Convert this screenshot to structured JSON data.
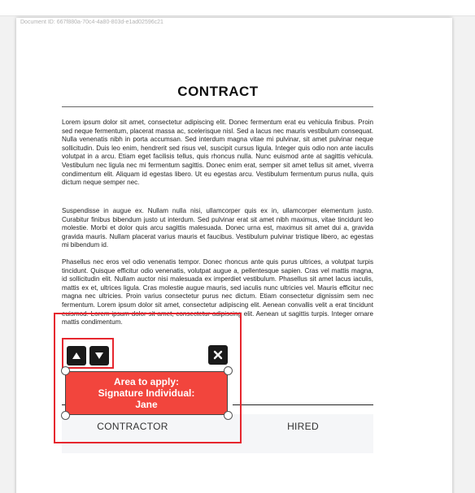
{
  "document": {
    "id_text": "Document ID: 667f880a-70c4-4a80-803d-e1ad02596c21",
    "title": "CONTRACT",
    "paragraphs": [
      "Lorem ipsum dolor sit amet, consectetur adipiscing elit. Donec fermentum erat eu vehicula finibus. Proin sed neque fermentum, placerat massa ac, scelerisque nisl. Sed a lacus nec mauris vestibulum consequat. Nulla venenatis nibh in porta accumsan. Sed interdum magna vitae mi pulvinar, sit amet pulvinar neque sollicitudin. Duis leo enim, hendrerit sed risus vel, suscipit cursus ligula. Integer quis odio non ante iaculis volutpat in a arcu. Etiam eget facilisis tellus, quis rhoncus nulla. Nunc euismod ante at sagittis vehicula. Vestibulum nec ligula nec mi fermentum sagittis. Donec enim erat, semper sit amet tellus sit amet, viverra condimentum elit. Aliquam id egestas libero. Ut eu egestas arcu. Vestibulum fermentum purus nulla, quis dictum neque semper nec.",
      "Suspendisse in augue ex. Nullam nulla nisi, ullamcorper quis ex in, ullamcorper elementum justo. Curabitur finibus bibendum justo ut interdum. Sed pulvinar erat sit amet nibh maximus, vitae tincidunt leo molestie. Morbi et dolor quis arcu sagittis malesuada. Donec urna est, maximus sit amet dui a, gravida gravida mauris. Nullam placerat varius mauris et faucibus. Vestibulum pulvinar tristique libero, ac egestas mi bibendum id.",
      "Phasellus nec eros vel odio venenatis tempor. Donec rhoncus ante quis purus ultrices, a volutpat turpis tincidunt. Quisque efficitur odio venenatis, volutpat augue a, pellentesque sapien. Cras vel mattis magna, id sollicitudin elit. Nullam auctor nisi malesuada ex imperdiet vestibulum. Phasellus sit amet lacus iaculis, mattis ex et, ultrices ligula. Cras molestie augue mauris, sed iaculis nunc ultricies vel. Mauris efficitur nec magna nec ultricies. Proin varius consectetur purus nec dictum. Etiam consectetur dignissim sem nec fermentum. Lorem ipsum dolor sit amet, consectetur adipiscing elit. Aenean convallis velit a erat tincidunt euismod. Lorem ipsum dolor sit amet, consectetur adipiscing elit. Aenean ut sagittis turpis. Integer ornare mattis condimentum."
    ],
    "signatures": {
      "left_label": "CONTRACTOR",
      "right_label": "HIRED"
    }
  },
  "signature_field": {
    "line1": "Area to apply:",
    "line2": "Signature Individual:",
    "line3": "Jane",
    "fill_color": "#f2453d",
    "outline_color": "#e6262e"
  },
  "controls": {
    "up_icon": "arrow-up-icon",
    "down_icon": "arrow-down-icon",
    "close_icon": "close-icon"
  }
}
